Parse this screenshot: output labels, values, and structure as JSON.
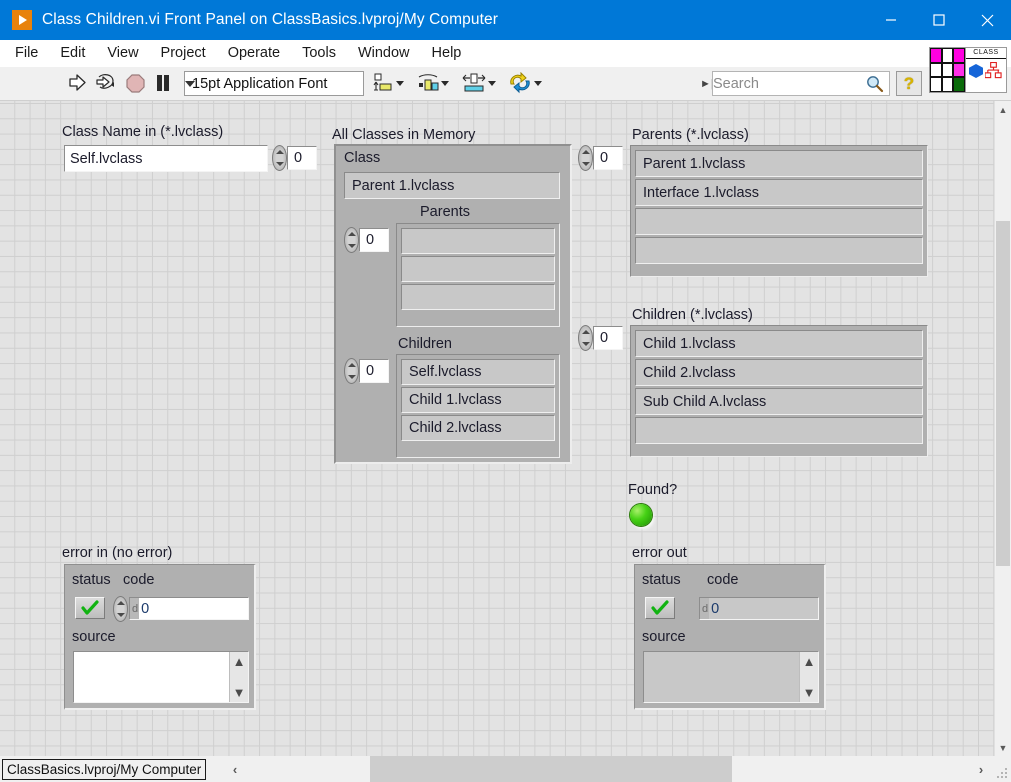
{
  "window": {
    "title": "Class Children.vi Front Panel on ClassBasics.lvproj/My Computer",
    "app_icon": "labview-run-icon",
    "minimize_label": "Minimize",
    "maximize_label": "Maximize",
    "close_label": "Close"
  },
  "menu": {
    "items": [
      {
        "label": "File"
      },
      {
        "label": "Edit"
      },
      {
        "label": "View"
      },
      {
        "label": "Project"
      },
      {
        "label": "Operate"
      },
      {
        "label": "Tools"
      },
      {
        "label": "Window"
      },
      {
        "label": "Help"
      }
    ]
  },
  "toolbar": {
    "run_icon": "run-arrow-icon",
    "run_continuous_icon": "run-continuously-icon",
    "abort_icon": "abort-execution-icon",
    "pause_icon": "pause-icon",
    "font_selector_value": "15pt Application Font",
    "align_icon": "align-objects-icon",
    "distribute_icon": "distribute-objects-icon",
    "resize_icon": "resize-objects-icon",
    "reorder_icon": "reorder-objects-icon",
    "search_placeholder": "Search",
    "search_value": "Search",
    "search_icon": "magnifier-icon",
    "help_icon": "context-help-icon",
    "vi_icon_name": "vi-icon",
    "connector_label": "CLASS",
    "connector_icon": "class-connector-icon"
  },
  "panel": {
    "class_name_in": {
      "label": "Class Name in (*.lvclass)",
      "value": "Self.lvclass",
      "index": "0"
    },
    "all_classes": {
      "label": "All Classes in Memory",
      "class_label": "Class",
      "class_value": "Parent 1.lvclass",
      "parents_label": "Parents",
      "parents_index": "0",
      "parents_items": [
        "",
        "",
        ""
      ],
      "children_label": "Children",
      "children_index": "0",
      "children_items": [
        "Self.lvclass",
        "Child 1.lvclass",
        "Child 2.lvclass"
      ]
    },
    "parents_array": {
      "label": "Parents (*.lvclass)",
      "index": "0",
      "items": [
        "Parent 1.lvclass",
        "Interface 1.lvclass",
        "",
        ""
      ]
    },
    "children_array": {
      "label": "Children (*.lvclass)",
      "index": "0",
      "items": [
        "Child 1.lvclass",
        "Child 2.lvclass",
        "Sub Child A.lvclass",
        ""
      ]
    },
    "found": {
      "label": "Found?",
      "state": "on",
      "color": "#46d215"
    },
    "error_in": {
      "label": "error in (no error)",
      "status_label": "status",
      "status_value": "no-error",
      "code_label": "code",
      "code_radix": "d",
      "code_value": "0",
      "source_label": "source",
      "source_value": ""
    },
    "error_out": {
      "label": "error out",
      "status_label": "status",
      "status_value": "no-error",
      "code_label": "code",
      "code_radix": "d",
      "code_value": "0",
      "source_label": "source",
      "source_value": ""
    }
  },
  "statusbar": {
    "context": "ClassBasics.lvproj/My Computer"
  },
  "colors": {
    "titlebar": "#0078d7",
    "panel_background": "#e3e3e3",
    "grid_line": "#cfcfcf",
    "control_grey": "#c8c8c8",
    "shell_grey": "#b0b0b0",
    "led_green": "#46d215"
  }
}
